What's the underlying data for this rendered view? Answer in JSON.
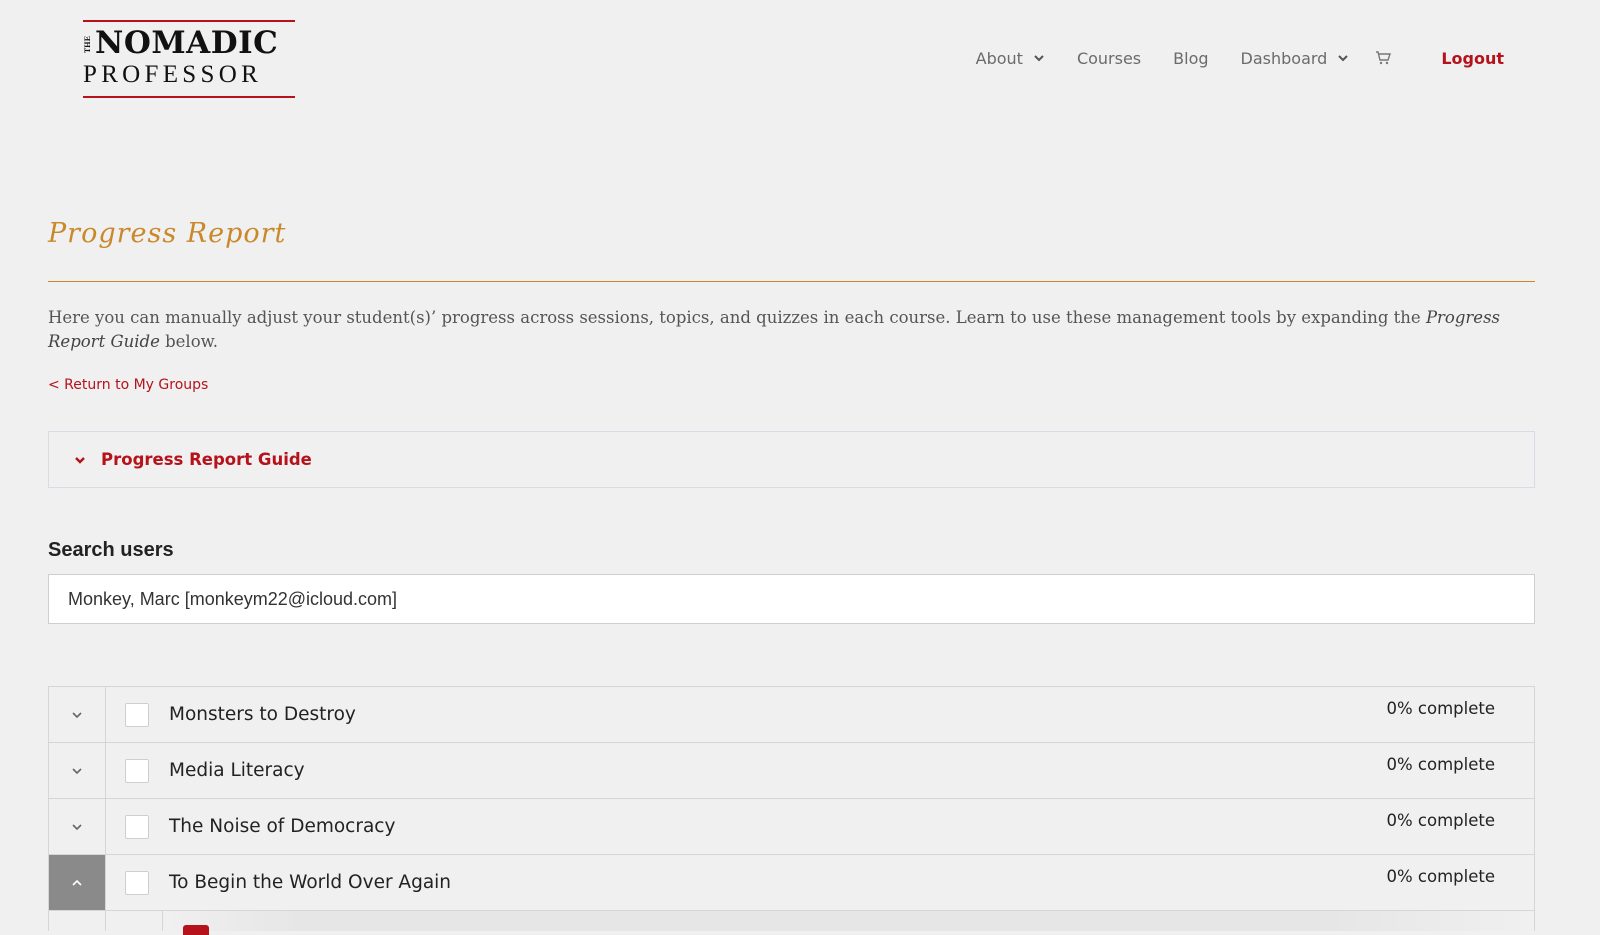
{
  "logo": {
    "the": "THE",
    "top": "NOMADIC",
    "bottom": "PROFESSOR",
    "accent": "#b5121b"
  },
  "nav": {
    "items": [
      {
        "label": "About",
        "has_dropdown": true
      },
      {
        "label": "Courses",
        "has_dropdown": false
      },
      {
        "label": "Blog",
        "has_dropdown": false
      },
      {
        "label": "Dashboard",
        "has_dropdown": true
      }
    ],
    "cart_icon": "cart-icon",
    "logout": "Logout"
  },
  "page": {
    "title": "Progress Report",
    "intro_text": "Here you can manually adjust your student(s)’ progress across sessions, topics, and quizzes in each course. Learn to use these management tools by expanding the ",
    "intro_emphasis": "Progress Report Guide",
    "intro_end": " below.",
    "return_link": "< Return to My Groups",
    "guide_label": "Progress Report Guide",
    "title_color": "#c9892b"
  },
  "search": {
    "label": "Search users",
    "value": "Monkey, Marc [monkeym22@icloud.com]"
  },
  "courses": [
    {
      "title": "Monsters to Destroy",
      "progress": "0% complete",
      "expanded": false
    },
    {
      "title": "Media Literacy",
      "progress": "0% complete",
      "expanded": false
    },
    {
      "title": "The Noise of Democracy",
      "progress": "0% complete",
      "expanded": false
    },
    {
      "title": "To Begin the World Over Again",
      "progress": "0% complete",
      "expanded": true
    }
  ]
}
